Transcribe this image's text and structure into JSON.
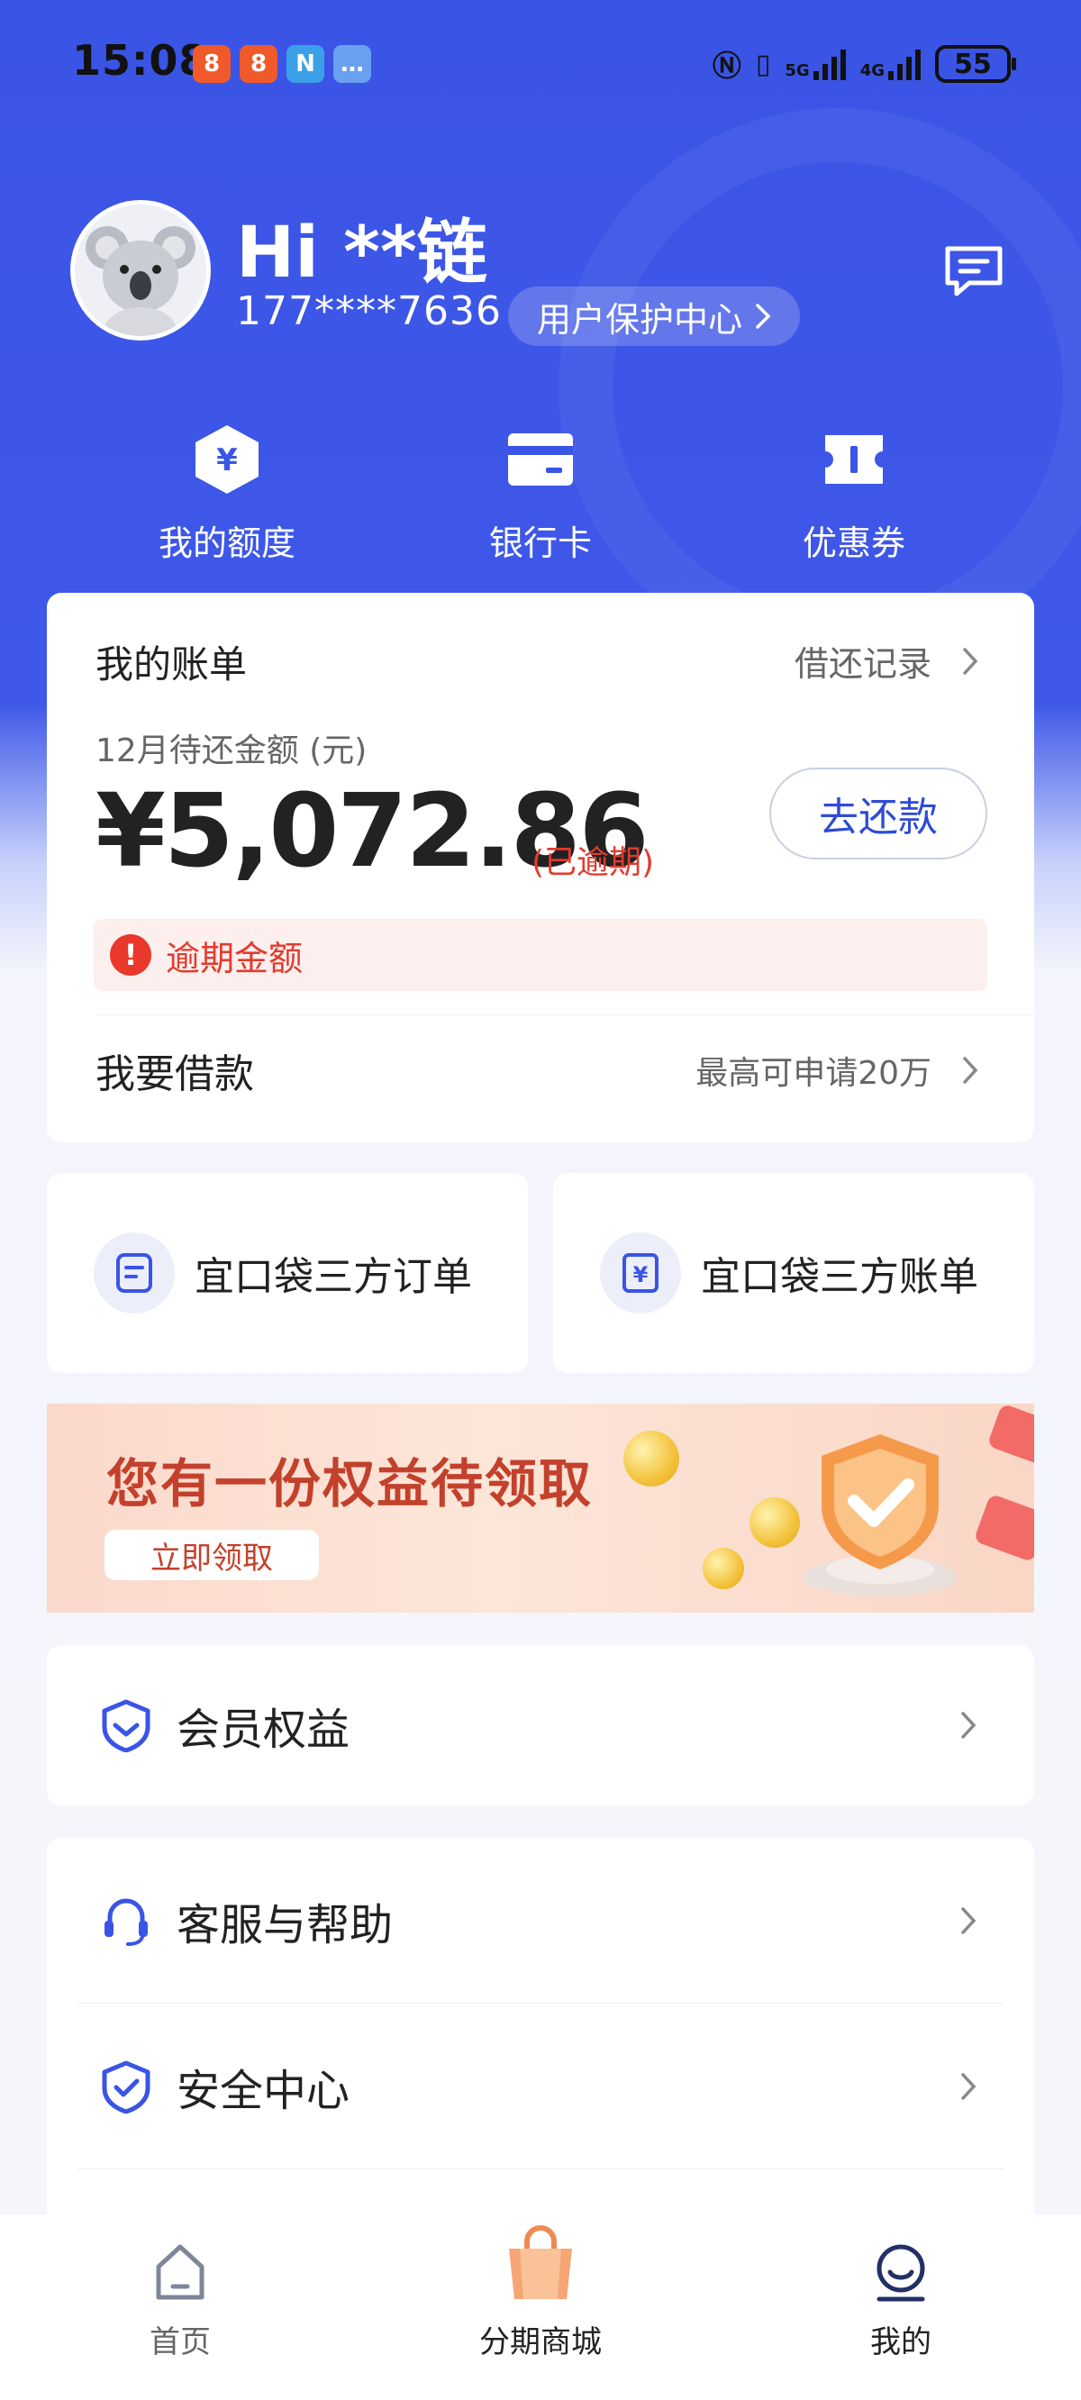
{
  "status_bar": {
    "time": "15:08",
    "network_5g": "5G",
    "network_4g": "4G",
    "battery": "55"
  },
  "profile": {
    "greeting": "Hi **链",
    "phone": "177****7636",
    "protection_center": "用户保护中心"
  },
  "quick_actions": [
    {
      "label": "我的额度",
      "icon": "yuan-hexagon-icon"
    },
    {
      "label": "银行卡",
      "icon": "bank-card-icon"
    },
    {
      "label": "优惠券",
      "icon": "coupon-icon"
    }
  ],
  "bill": {
    "title": "我的账单",
    "record_link": "借还记录",
    "subtitle": "12月待还金额 (元)",
    "amount": "¥5,072.86",
    "status": "(已逾期)",
    "repay_button": "去还款",
    "warning_text": "逾期金额",
    "warning_icon": "!",
    "loan_title": "我要借款",
    "loan_max": "最高可申请20万"
  },
  "orders": [
    {
      "label": "宜口袋三方订单",
      "icon": "order-document-icon"
    },
    {
      "label": "宜口袋三方账单",
      "icon": "yuan-bill-icon"
    }
  ],
  "banner": {
    "title": "您有一份权益待领取",
    "button": "立即领取"
  },
  "menu": [
    {
      "label": "会员权益",
      "icon": "member-shield-icon"
    },
    {
      "label": "客服与帮助",
      "icon": "headset-icon"
    },
    {
      "label": "安全中心",
      "icon": "security-shield-icon"
    }
  ],
  "tabbar": [
    {
      "label": "首页",
      "icon": "home-icon",
      "active": false
    },
    {
      "label": "分期商城",
      "icon": "shopping-bag-icon",
      "active": false
    },
    {
      "label": "我的",
      "icon": "profile-icon",
      "active": true
    }
  ],
  "colors": {
    "primary": "#3a54e6",
    "danger": "#e23b2e",
    "link": "#2f4bd6"
  }
}
